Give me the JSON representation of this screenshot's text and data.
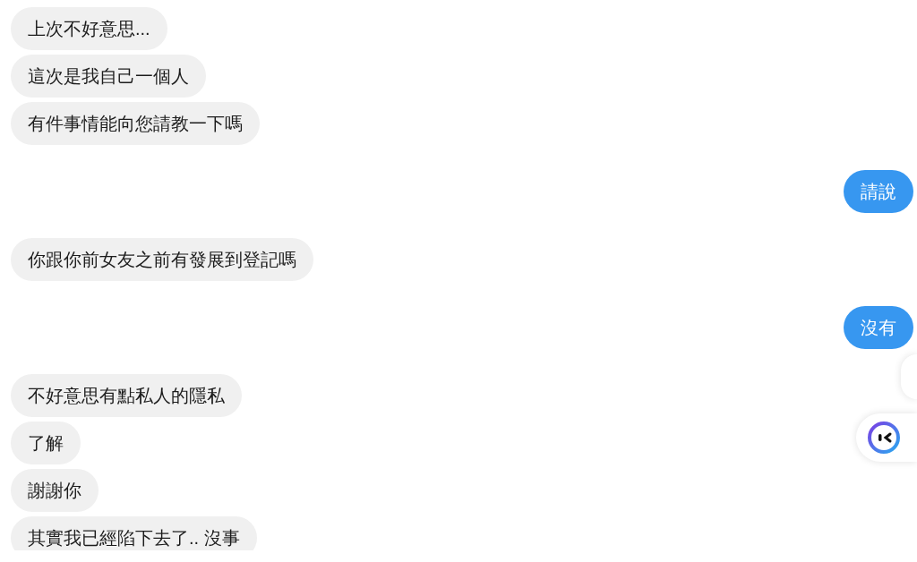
{
  "groups": [
    {
      "kind": "incoming",
      "messages": [
        "上次不好意思...",
        "這次是我自己一個人",
        "有件事情能向您請教一下嗎"
      ]
    },
    {
      "kind": "outgoing",
      "messages": [
        "請說"
      ]
    },
    {
      "kind": "incoming",
      "messages": [
        "你跟你前女友之前有發展到登記嗎"
      ]
    },
    {
      "kind": "outgoing",
      "messages": [
        "沒有"
      ]
    },
    {
      "kind": "incoming",
      "messages": [
        "不好意思有點私人的隱私",
        "了解",
        "謝謝你",
        "其實我已經陷下去了.. 沒事"
      ]
    }
  ]
}
